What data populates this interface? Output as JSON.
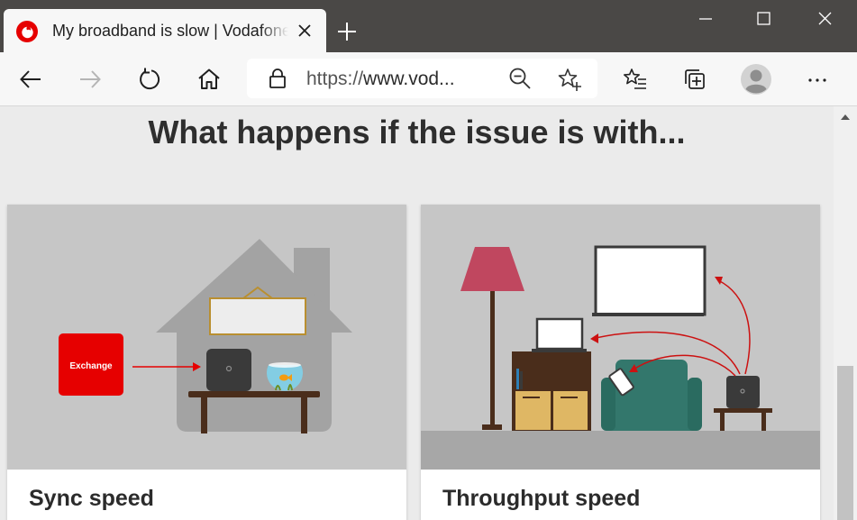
{
  "browser": {
    "tab_title": "My broadband is slow | Vodafone UK",
    "url_scheme": "https://",
    "url_host": "www.vod..."
  },
  "page": {
    "heading": "What happens if the issue is with...",
    "cards": [
      {
        "title": "Sync speed",
        "illustration_label": "Exchange"
      },
      {
        "title": "Throughput speed"
      }
    ]
  },
  "colors": {
    "vodafone_red": "#e60000",
    "titlebar": "#4a4846",
    "toolbar": "#f7f7f7",
    "page_bg": "#ebebeb"
  },
  "icons": {
    "back": "arrow-left-icon",
    "forward": "arrow-right-icon",
    "refresh": "refresh-icon",
    "home": "home-icon",
    "lock": "lock-icon",
    "zoom": "zoom-icon",
    "favorite": "star-add-icon",
    "favorites_list": "favorites-icon",
    "collections": "collections-icon",
    "profile": "profile-icon",
    "more": "more-icon"
  }
}
